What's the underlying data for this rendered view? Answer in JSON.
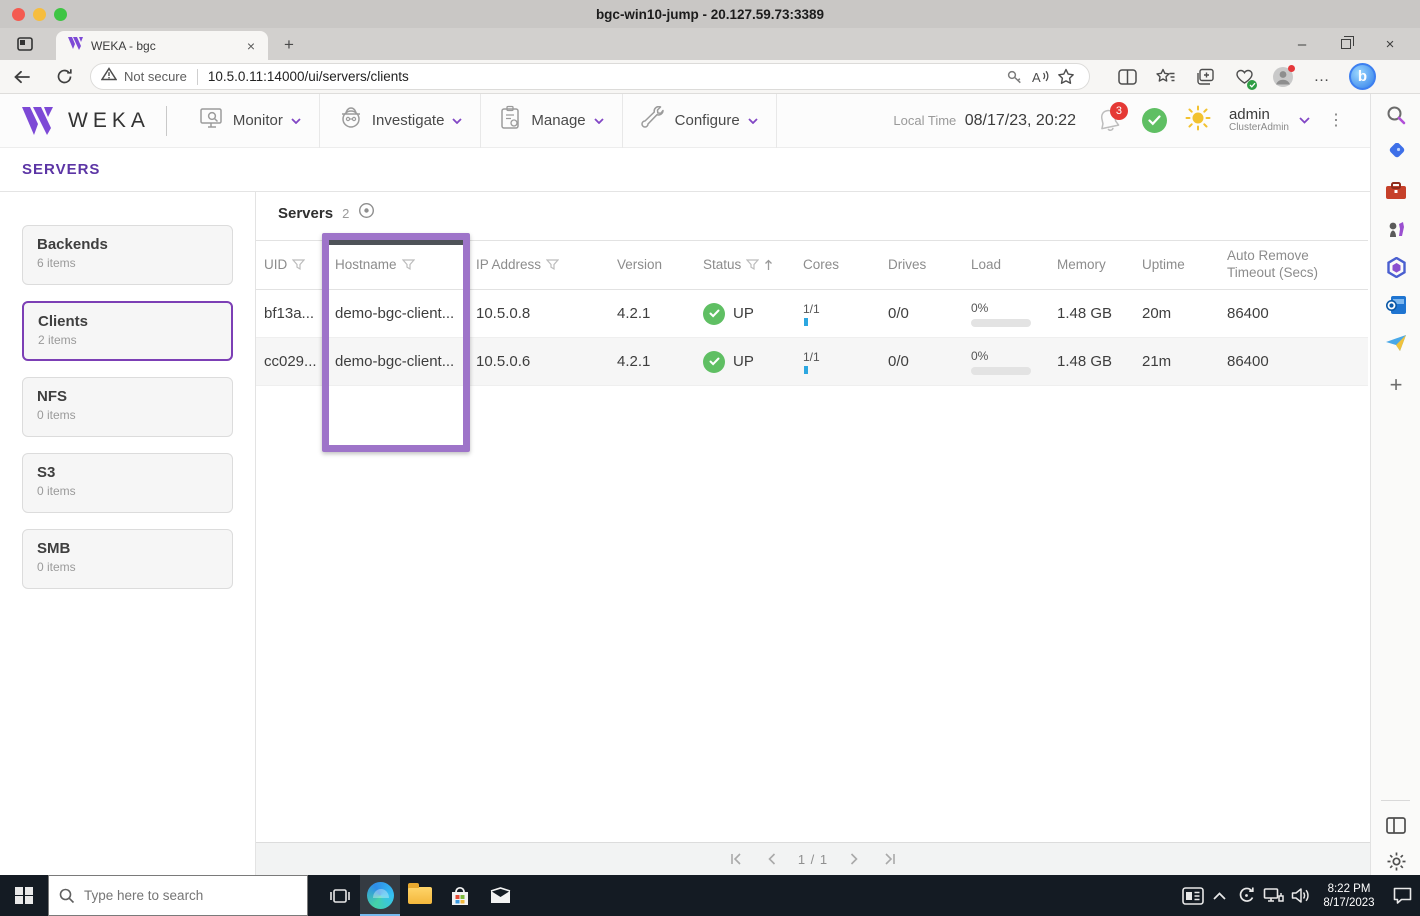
{
  "rdp": {
    "title": "bgc-win10-jump - 20.127.59.73:3389"
  },
  "browser": {
    "tab_title": "WEKA - bgc",
    "security_label": "Not secure",
    "url": "10.5.0.11:14000/ui/servers/clients"
  },
  "glyphs": {
    "close_tab": "×",
    "new_tab": "+",
    "minimize": "–",
    "close_window": "×",
    "ellipsis": "…",
    "kebab": "⋮",
    "plus": "+"
  },
  "header": {
    "brand": "WEKA",
    "menus": [
      {
        "label": "Monitor"
      },
      {
        "label": "Investigate"
      },
      {
        "label": "Manage"
      },
      {
        "label": "Configure"
      }
    ],
    "local_time_label": "Local Time",
    "local_time_value": "08/17/23, 20:22",
    "notification_count": "3",
    "user": {
      "name": "admin",
      "role": "ClusterAdmin"
    }
  },
  "page": {
    "title": "SERVERS"
  },
  "sidebar": {
    "items": [
      {
        "label": "Backends",
        "count": "6 items"
      },
      {
        "label": "Clients",
        "count": "2 items"
      },
      {
        "label": "NFS",
        "count": "0 items"
      },
      {
        "label": "S3",
        "count": "0 items"
      },
      {
        "label": "SMB",
        "count": "0 items"
      }
    ]
  },
  "table": {
    "title": "Servers",
    "total": "2",
    "columns": [
      "UID",
      "Hostname",
      "IP Address",
      "Version",
      "Status",
      "Cores",
      "Drives",
      "Load",
      "Memory",
      "Uptime",
      "Auto Remove Timeout (Secs)"
    ],
    "rows": [
      {
        "uid": "bf13a...",
        "hostname": "demo-bgc-client...",
        "ip": "10.5.0.8",
        "version": "4.2.1",
        "status": "UP",
        "cores": "1/1",
        "drives": "0/0",
        "load": "0%",
        "memory": "1.48 GB",
        "uptime": "20m",
        "timeout": "86400"
      },
      {
        "uid": "cc029...",
        "hostname": "demo-bgc-client...",
        "ip": "10.5.0.6",
        "version": "4.2.1",
        "status": "UP",
        "cores": "1/1",
        "drives": "0/0",
        "load": "0%",
        "memory": "1.48 GB",
        "uptime": "21m",
        "timeout": "86400"
      }
    ],
    "pagination": "1 / 1"
  },
  "taskbar": {
    "search_placeholder": "Type here to search",
    "time": "8:22 PM",
    "date": "8/17/2023"
  },
  "colors": {
    "brand_purple": "#7d49d6",
    "title_purple": "#5c35a5",
    "highlight_purple": "#9e74c9",
    "selected_card_border": "#7c3fb5",
    "status_green": "#5fbf63",
    "badge_red": "#e53935",
    "cores_bar_blue": "#2da7e0",
    "taskbar_dark": "#141b23"
  }
}
